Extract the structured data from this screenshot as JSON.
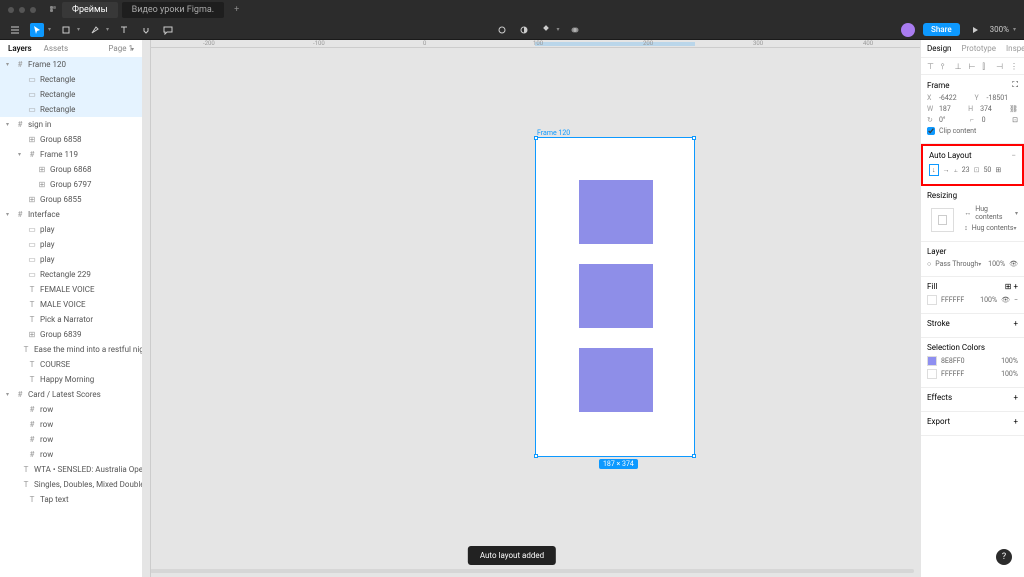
{
  "tabs": {
    "active": "Фреймы",
    "other": "Видео уроки Figma."
  },
  "toolbar": {
    "share": "Share",
    "zoom": "300%"
  },
  "leftPanel": {
    "layersTab": "Layers",
    "assetsTab": "Assets",
    "page": "Page 1",
    "items": [
      {
        "label": "Frame 120",
        "indent": 0,
        "selected": true,
        "caret": true,
        "icon": "frame"
      },
      {
        "label": "Rectangle",
        "indent": 1,
        "selected": true,
        "icon": "rect"
      },
      {
        "label": "Rectangle",
        "indent": 1,
        "selected": true,
        "icon": "rect"
      },
      {
        "label": "Rectangle",
        "indent": 1,
        "selected": true,
        "icon": "rect"
      },
      {
        "label": "sign in",
        "indent": 0,
        "caret": true,
        "icon": "frame"
      },
      {
        "label": "Group 6858",
        "indent": 1,
        "icon": "group"
      },
      {
        "label": "Frame 119",
        "indent": 1,
        "caret": true,
        "icon": "frame"
      },
      {
        "label": "Group 6868",
        "indent": 2,
        "icon": "group"
      },
      {
        "label": "Group 6797",
        "indent": 2,
        "icon": "group"
      },
      {
        "label": "Group 6855",
        "indent": 1,
        "icon": "group"
      },
      {
        "label": "Interface",
        "indent": 0,
        "caret": true,
        "icon": "frame"
      },
      {
        "label": "play",
        "indent": 1,
        "icon": "rect"
      },
      {
        "label": "play",
        "indent": 1,
        "icon": "rect"
      },
      {
        "label": "play",
        "indent": 1,
        "icon": "rect"
      },
      {
        "label": "Rectangle 229",
        "indent": 1,
        "icon": "rect"
      },
      {
        "label": "FEMALE VOICE",
        "indent": 1,
        "icon": "text"
      },
      {
        "label": "MALE VOICE",
        "indent": 1,
        "icon": "text"
      },
      {
        "label": "Pick a Narrator",
        "indent": 1,
        "icon": "text"
      },
      {
        "label": "Group 6839",
        "indent": 1,
        "icon": "group"
      },
      {
        "label": "Ease the mind into a restful night's sleep with t...",
        "indent": 1,
        "icon": "text"
      },
      {
        "label": "COURSE",
        "indent": 1,
        "icon": "text"
      },
      {
        "label": "Happy Morning",
        "indent": 1,
        "icon": "text"
      },
      {
        "label": "Card / Latest Scores",
        "indent": 0,
        "caret": true,
        "icon": "frame"
      },
      {
        "label": "row",
        "indent": 1,
        "icon": "frame"
      },
      {
        "label": "row",
        "indent": 1,
        "icon": "frame"
      },
      {
        "label": "row",
        "indent": 1,
        "icon": "frame"
      },
      {
        "label": "row",
        "indent": 1,
        "icon": "frame"
      },
      {
        "label": "WTA • SENSLED: Australia Open, hard",
        "indent": 1,
        "icon": "text"
      },
      {
        "label": "Singles, Doubles, Mixed Doubles",
        "indent": 1,
        "icon": "text"
      },
      {
        "label": "Tap text",
        "indent": 1,
        "icon": "text"
      }
    ]
  },
  "ruler": {
    "marks": [
      "-200",
      "-100",
      "0",
      "100",
      "200",
      "300",
      "400"
    ]
  },
  "canvasFrame": {
    "label": "Frame 120",
    "dim": "187 × 374"
  },
  "rightPanel": {
    "tabs": {
      "design": "Design",
      "prototype": "Prototype",
      "inspect": "Inspect"
    },
    "frame": {
      "title": "Frame",
      "x_label": "X",
      "x": "-6422",
      "y_label": "Y",
      "y": "-18501",
      "w_label": "W",
      "w": "187",
      "h_label": "H",
      "h": "374",
      "rot_label": "↻",
      "rot": "0°",
      "rad_label": "⌐",
      "rad": "0",
      "clip": "Clip content"
    },
    "autoLayout": {
      "title": "Auto Layout",
      "spacing": "23",
      "padding": "50"
    },
    "resizing": {
      "title": "Resizing",
      "horiz": "Hug contents",
      "vert": "Hug contents"
    },
    "layer": {
      "title": "Layer",
      "blend": "Pass Through",
      "opacity": "100%"
    },
    "fill": {
      "title": "Fill",
      "hex": "FFFFFF",
      "opacity": "100%"
    },
    "stroke": {
      "title": "Stroke"
    },
    "selectionColors": {
      "title": "Selection Colors",
      "c1_hex": "8E8FF0",
      "c1_op": "100%",
      "c2_hex": "FFFFFF",
      "c2_op": "100%"
    },
    "effects": {
      "title": "Effects"
    },
    "export": {
      "title": "Export"
    }
  },
  "toast": "Auto layout added",
  "help": "?"
}
